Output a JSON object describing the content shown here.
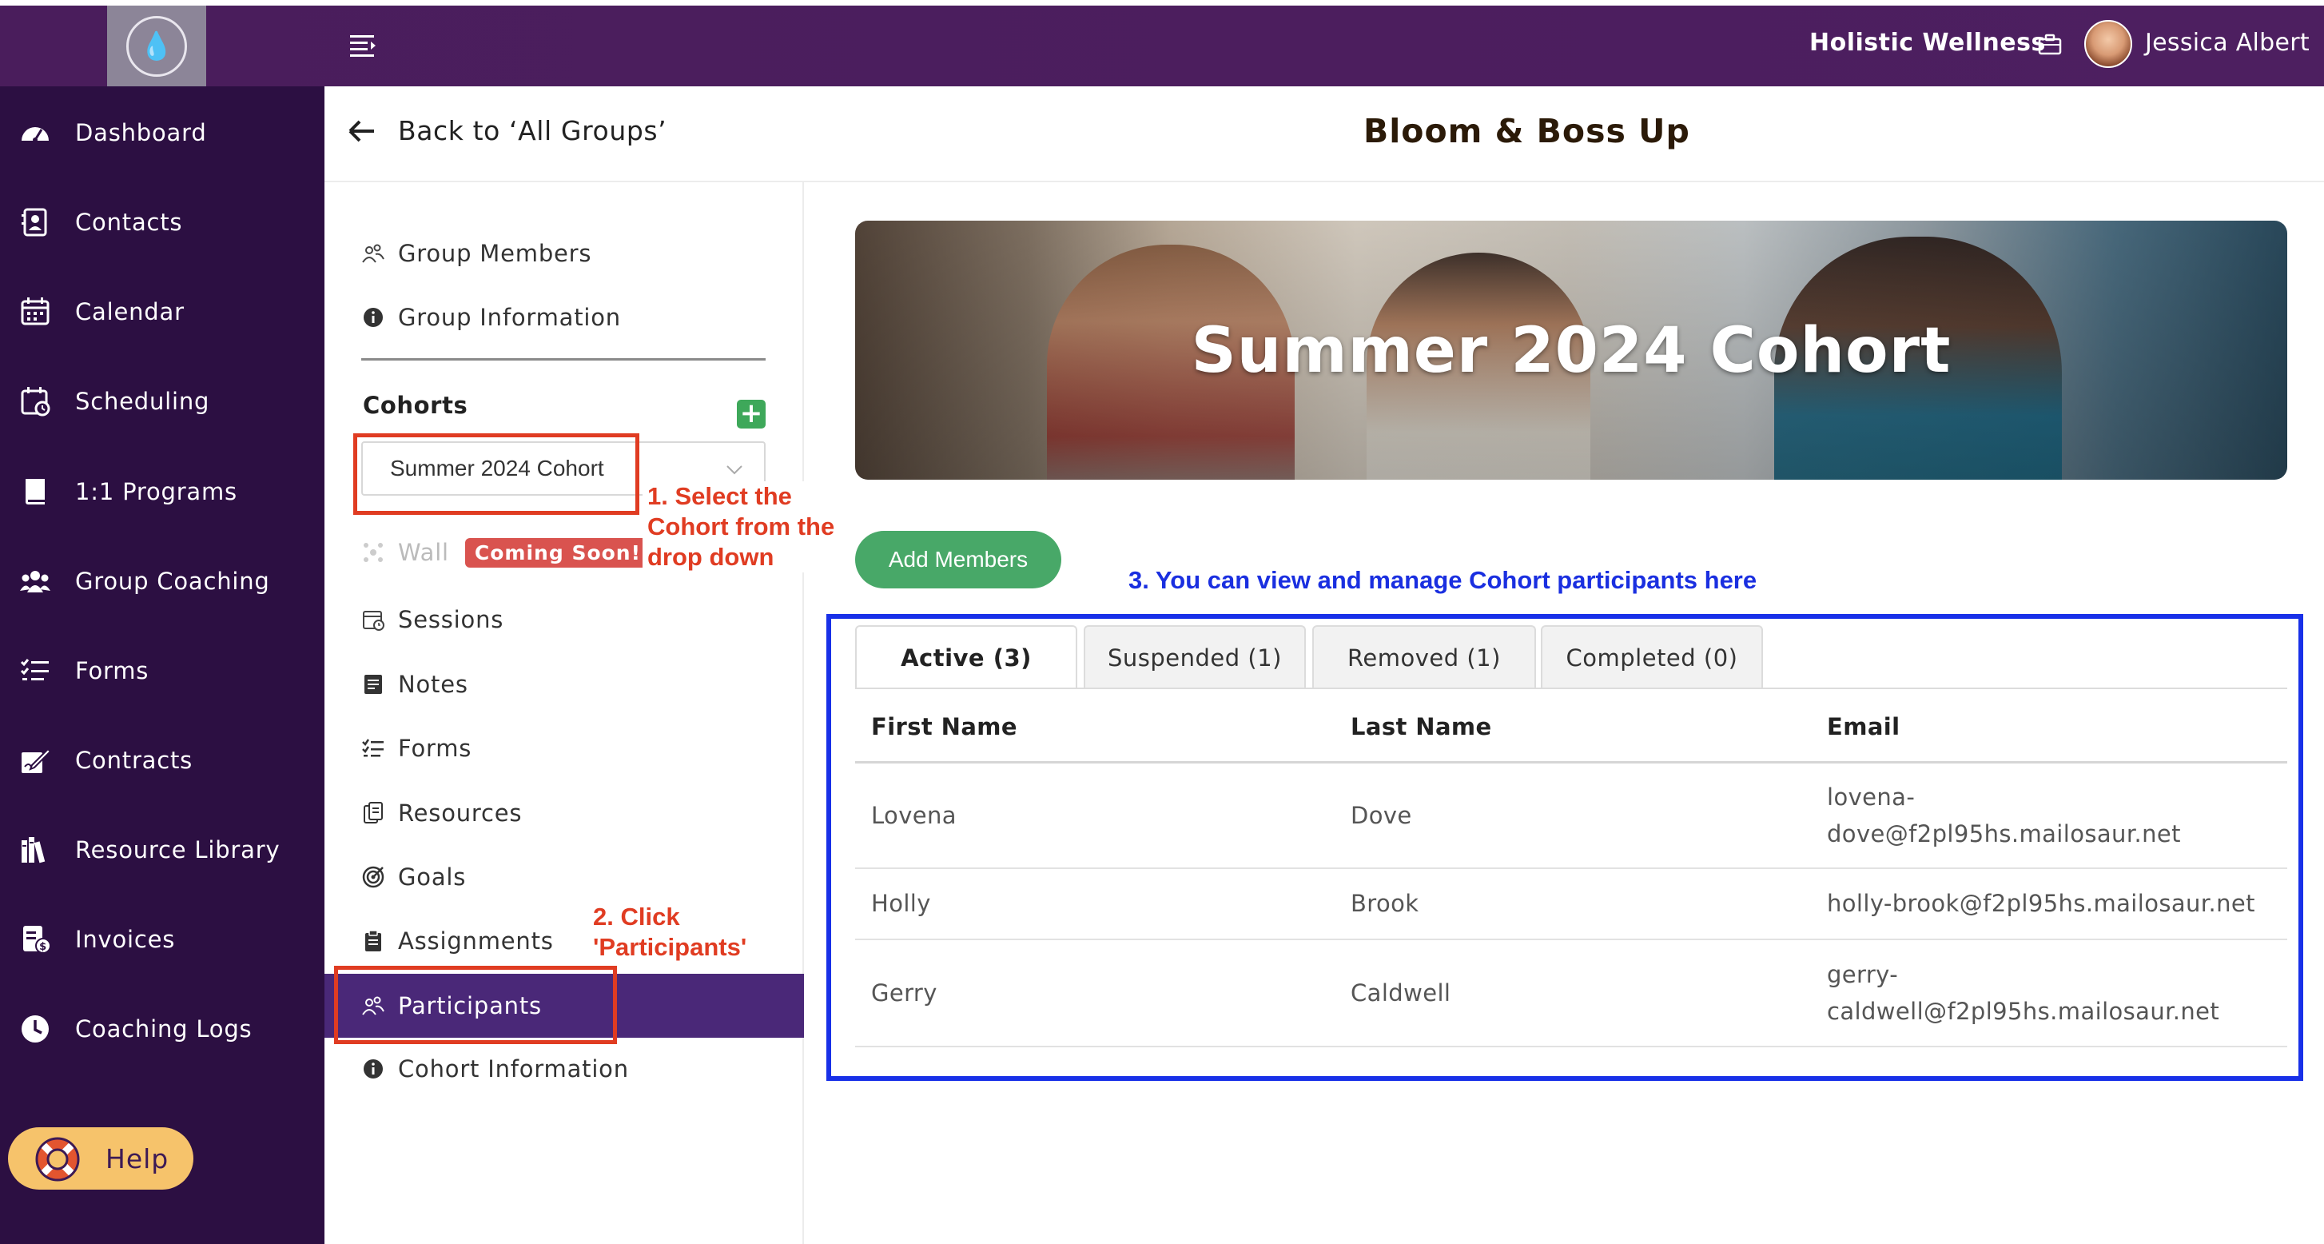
{
  "header": {
    "org_name": "Holistic Wellness",
    "user_name": "Jessica Albert",
    "logo_mark": "💧"
  },
  "sidebar": {
    "items": [
      {
        "label": "Dashboard",
        "icon": "dashboard-icon"
      },
      {
        "label": "Contacts",
        "icon": "contacts-icon"
      },
      {
        "label": "Calendar",
        "icon": "calendar-icon"
      },
      {
        "label": "Scheduling",
        "icon": "scheduling-icon"
      },
      {
        "label": "1:1 Programs",
        "icon": "book-icon"
      },
      {
        "label": "Group Coaching",
        "icon": "group-icon"
      },
      {
        "label": "Forms",
        "icon": "forms-icon"
      },
      {
        "label": "Contracts",
        "icon": "contract-icon"
      },
      {
        "label": "Resource Library",
        "icon": "library-icon"
      },
      {
        "label": "Invoices",
        "icon": "invoice-icon"
      },
      {
        "label": "Coaching Logs",
        "icon": "clock-icon"
      }
    ],
    "help_label": "Help"
  },
  "subheader": {
    "back_label": "Back to ‘All Groups’",
    "title": "Bloom & Boss Up"
  },
  "group_menu": {
    "group_members": "Group Members",
    "group_information": "Group Information",
    "cohorts_label": "Cohorts",
    "add_cohort": "+",
    "selected_cohort": "Summer 2024 Cohort",
    "wall": "Wall",
    "coming_soon": "Coming Soon!",
    "sessions": "Sessions",
    "notes": "Notes",
    "forms": "Forms",
    "resources": "Resources",
    "goals": "Goals",
    "assignments": "Assignments",
    "participants": "Participants",
    "cohort_information": "Cohort Information"
  },
  "annotations": {
    "step1": [
      "1. Select the",
      "Cohort from the",
      "drop down"
    ],
    "step2": [
      "2. Click",
      "'Participants'"
    ],
    "step3": "3. You can view and manage Cohort participants here"
  },
  "main": {
    "banner_title": "Summer 2024 Cohort",
    "add_members_label": "Add Members",
    "tabs": [
      {
        "label": "Active (3)",
        "active": true
      },
      {
        "label": "Suspended (1)",
        "active": false
      },
      {
        "label": "Removed (1)",
        "active": false
      },
      {
        "label": "Completed (0)",
        "active": false
      }
    ],
    "columns": [
      "First Name",
      "Last Name",
      "Email"
    ],
    "rows": [
      {
        "first": "Lovena",
        "last": "Dove",
        "email_1": "lovena-",
        "email_2": "dove@f2pl95hs.mailosaur.net"
      },
      {
        "first": "Holly",
        "last": "Brook",
        "email_1": "holly-brook@f2pl95hs.mailosaur.net",
        "email_2": ""
      },
      {
        "first": "Gerry",
        "last": "Caldwell",
        "email_1": "gerry-",
        "email_2": "caldwell@f2pl95hs.mailosaur.net"
      }
    ]
  },
  "colors": {
    "topbar": "#4a1d5c",
    "sidebar": "#2c0f42",
    "active_item": "#4a2878",
    "accent_green": "#48a868",
    "annotation_red": "#e03c22",
    "annotation_blue": "#1830e8"
  }
}
